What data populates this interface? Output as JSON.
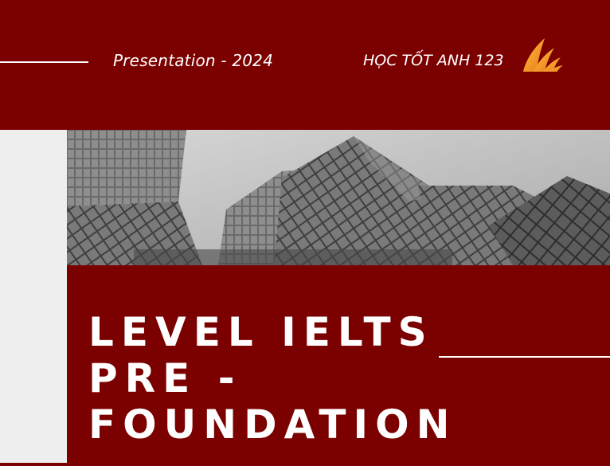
{
  "header": {
    "subtitle": "Presentation - 2024",
    "brand": "HỌC TỐT ANH 123",
    "logo_icon": "orange-wing-logo"
  },
  "title": {
    "line1": "LEVEL IELTS",
    "line2": "PRE -",
    "line3": "FOUNDATION"
  },
  "colors": {
    "background": "#7b0000",
    "side_panel": "#eeeeef",
    "text": "#ffffff",
    "logo_orange": "#f5a623"
  },
  "image": {
    "subject": "grayscale-skyscrapers-photo"
  }
}
